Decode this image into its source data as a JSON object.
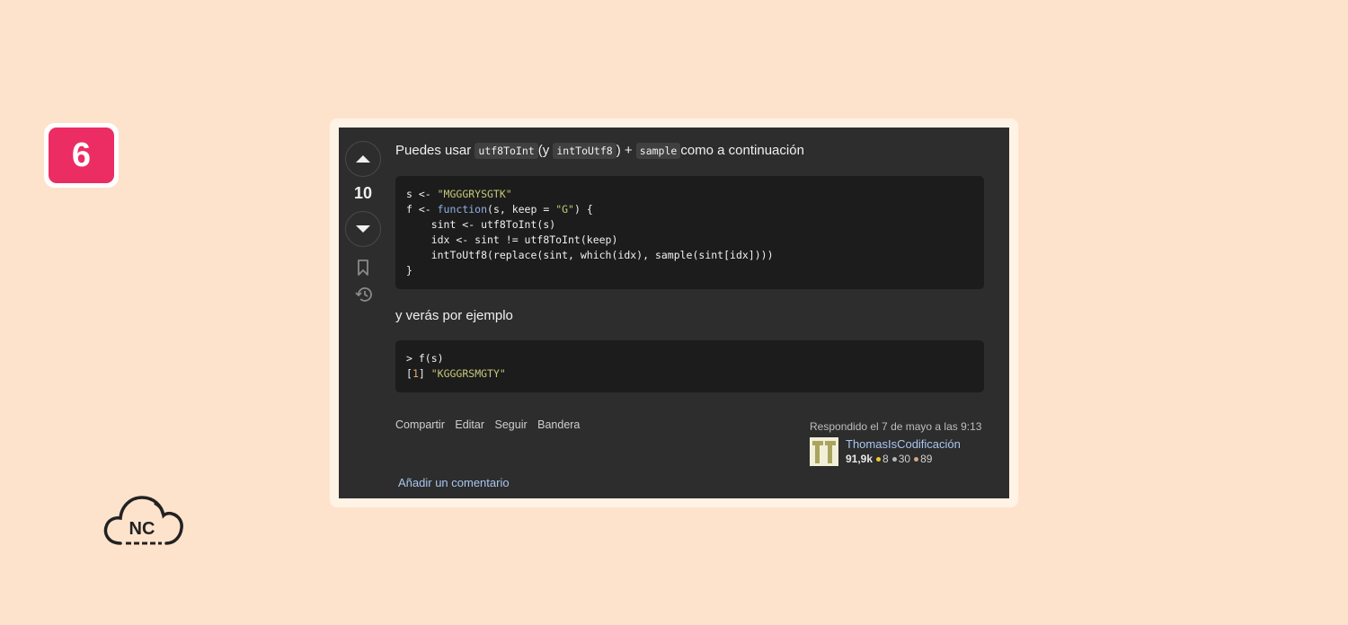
{
  "badge": {
    "number": "6"
  },
  "logo": {
    "text": "NC"
  },
  "answer": {
    "vote_count": "10",
    "intro": {
      "text1": "Puedes usar ",
      "code1": "utf8ToInt",
      "text2": "(y ",
      "code2": "intToUtf8",
      "text3": ") + ",
      "code3": "sample",
      "text4": "como a continuación"
    },
    "code_lines": [
      [
        "s <- ",
        "\"MGGGRYSGTK\""
      ],
      [
        "f <- ",
        "function",
        "(s, keep = ",
        "\"G\"",
        ") {"
      ],
      [
        "    sint <- utf8ToInt(s)"
      ],
      [
        "    idx <- sint != utf8ToInt(keep)"
      ],
      [
        "    intToUtf8(replace(sint, which(idx), sample(sint[idx])))"
      ],
      [
        "}"
      ]
    ],
    "para2": "y verás por ejemplo",
    "output_lines": [
      [
        "> f(s)"
      ],
      [
        "[",
        "1",
        "] ",
        "\"KGGGRSMGTY\""
      ]
    ],
    "menu": {
      "share": "Compartir",
      "edit": "Editar",
      "follow": "Seguir",
      "flag": "Bandera"
    },
    "signature": {
      "answered": "Respondido el 7 de mayo a las 9:13",
      "username": "ThomasIsCodificación",
      "reputation": "91,9k",
      "gold": "8",
      "silver": "30",
      "bronze": "89",
      "gold_color": "#f1c82d",
      "silver_color": "#b4b8bc",
      "bronze_color": "#d1a684"
    },
    "add_comment": "Añadir un comentario"
  },
  "colors": {
    "background": "#fee3cc",
    "badge": "#eb2d64",
    "panel": "#2d2d2d",
    "link": "#a8c7f0"
  }
}
